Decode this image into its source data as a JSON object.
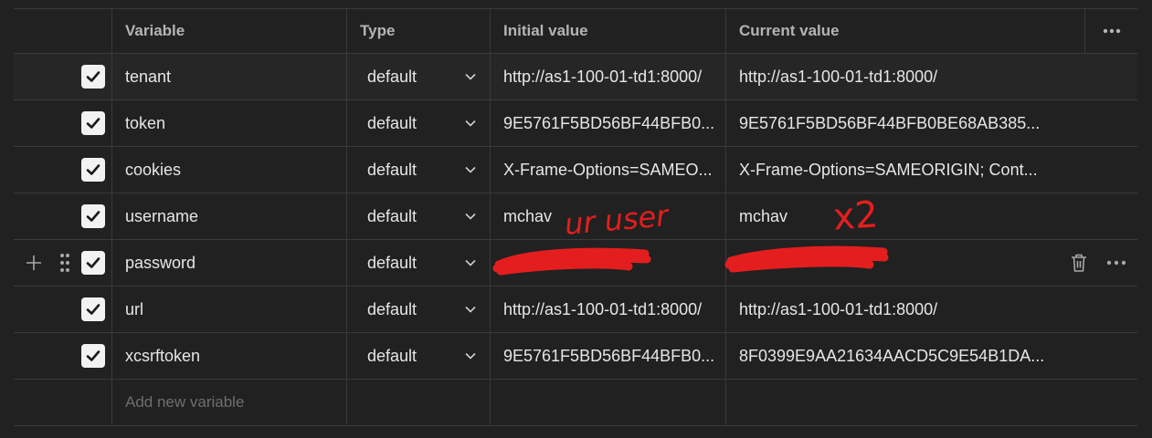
{
  "header": {
    "variable": "Variable",
    "type": "Type",
    "initial": "Initial value",
    "current": "Current value"
  },
  "rows": [
    {
      "variable": "tenant",
      "type": "default",
      "initial": "http://as1-100-01-td1:8000/",
      "current": "http://as1-100-01-td1:8000/",
      "checked": true
    },
    {
      "variable": "token",
      "type": "default",
      "initial": "9E5761F5BD56BF44BFB0...",
      "current": "9E5761F5BD56BF44BFB0BE68AB385...",
      "checked": true
    },
    {
      "variable": "cookies",
      "type": "default",
      "initial": "X-Frame-Options=SAMEO...",
      "current": "X-Frame-Options=SAMEORIGIN; Cont...",
      "checked": true
    },
    {
      "variable": "username",
      "type": "default",
      "initial": "mchav",
      "current": "mchav",
      "checked": true
    },
    {
      "variable": "password",
      "type": "default",
      "initial": "",
      "current": "",
      "checked": true
    },
    {
      "variable": "url",
      "type": "default",
      "initial": "http://as1-100-01-td1:8000/",
      "current": "http://as1-100-01-td1:8000/",
      "checked": true
    },
    {
      "variable": "xcsrftoken",
      "type": "default",
      "initial": "9E5761F5BD56BF44BFB0...",
      "current": "8F0399E9AA21634AACD5C9E54B1DA...",
      "checked": true
    }
  ],
  "new_row": {
    "placeholder": "Add new variable"
  },
  "annotations": {
    "user_note": "ur user",
    "x2_note": "x2",
    "ink_color": "#e41e1e"
  },
  "icons": {
    "checkbox": "checkmark-icon",
    "type_caret": "chevron-down-icon",
    "add": "plus-icon",
    "drag": "drag-handle-icon",
    "delete": "trash-icon",
    "more": "more-options-icon"
  },
  "colors": {
    "background": "#212121",
    "border": "#3a3a3a",
    "text": "#e6e6e6",
    "header_text": "#b4b4b4",
    "placeholder": "#6e6e6e"
  }
}
